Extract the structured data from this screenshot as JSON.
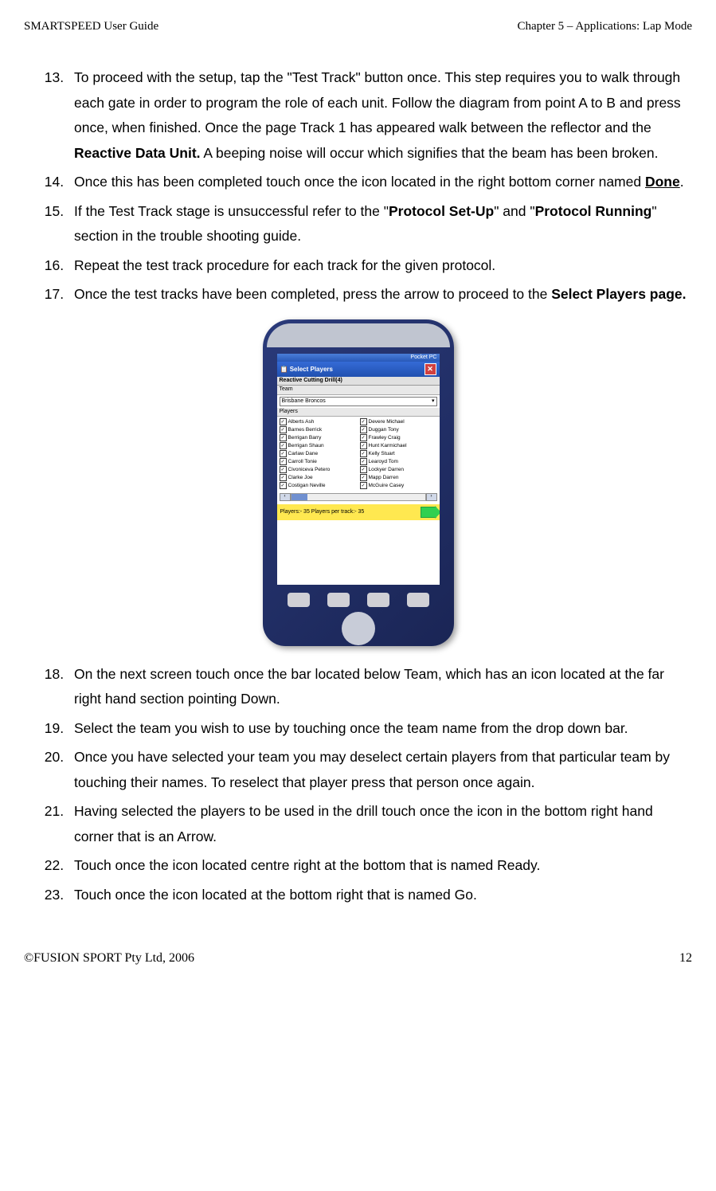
{
  "header": {
    "left": "SMARTSPEED User Guide",
    "right": "Chapter 5 – Applications: Lap Mode"
  },
  "footer": {
    "left": "©FUSION SPORT Pty Ltd, 2006",
    "right": "12"
  },
  "steps": {
    "s13a": "To proceed with the setup, tap the \"Test Track\" button once. This step requires you to walk through each gate in order to program the role of each unit. Follow the diagram from point A to B and press once, when finished. Once the page Track 1 has appeared walk between the reflector and the ",
    "s13b": "Reactive Data Unit.",
    "s13c": " A beeping noise will occur which signifies that the beam has been broken.",
    "s14a": "Once this has been completed touch once the icon located in the right bottom corner named ",
    "s14b": "Done",
    "s14c": ".",
    "s15a": "If the Test Track stage is unsuccessful refer to the \"",
    "s15b": "Protocol Set-Up",
    "s15c": "\" and \"",
    "s15d": "Protocol Running",
    "s15e": "\" section in the trouble shooting guide.",
    "s16": "Repeat the test track procedure for each track for the given protocol.",
    "s17a": "Once the test tracks have been completed, press the arrow to proceed to the ",
    "s17b": "Select Players page.",
    "s18": "On the next screen touch once the bar located below Team, which has an icon located at the far right hand section pointing Down.",
    "s19": "Select the team you wish to use by touching once the team name from the drop down bar.",
    "s20": "Once you have selected your team you may deselect certain players from that particular team by touching their names. To reselect that player press that person once again.",
    "s21": "Having selected the players to be used in the drill touch once the icon in the bottom right hand corner that is an Arrow.",
    "s22": "Touch once the icon located centre right at the bottom that is named Ready.",
    "s23": "Touch once the icon located at the bottom right that is named Go."
  },
  "pda": {
    "statusbar": "Pocket PC",
    "title": "Select Players",
    "drill": "Reactive Cutting Drill(4)",
    "team_header": "Team",
    "team_value": "Brisbane Broncos",
    "players_header": "Players",
    "left_players": [
      "Alberts Ash",
      "Barnes Berrick",
      "Berrigan Barry",
      "Berrigan Shaun",
      "Carlaw Dane",
      "Carroll Tonie",
      "Civoniceva Petero",
      "Clarke Joe",
      "Costigan Neville"
    ],
    "right_players": [
      "Devere Michael",
      "Duggan Tony",
      "Frawley Craig",
      "Hunt Karmichael",
      "Kelly Stuart",
      "Learoyd Tom",
      "Lockyer Darren",
      "Mapp Darren",
      "McGuire Casey"
    ],
    "status": "Players:- 35  Players per track:- 35"
  }
}
